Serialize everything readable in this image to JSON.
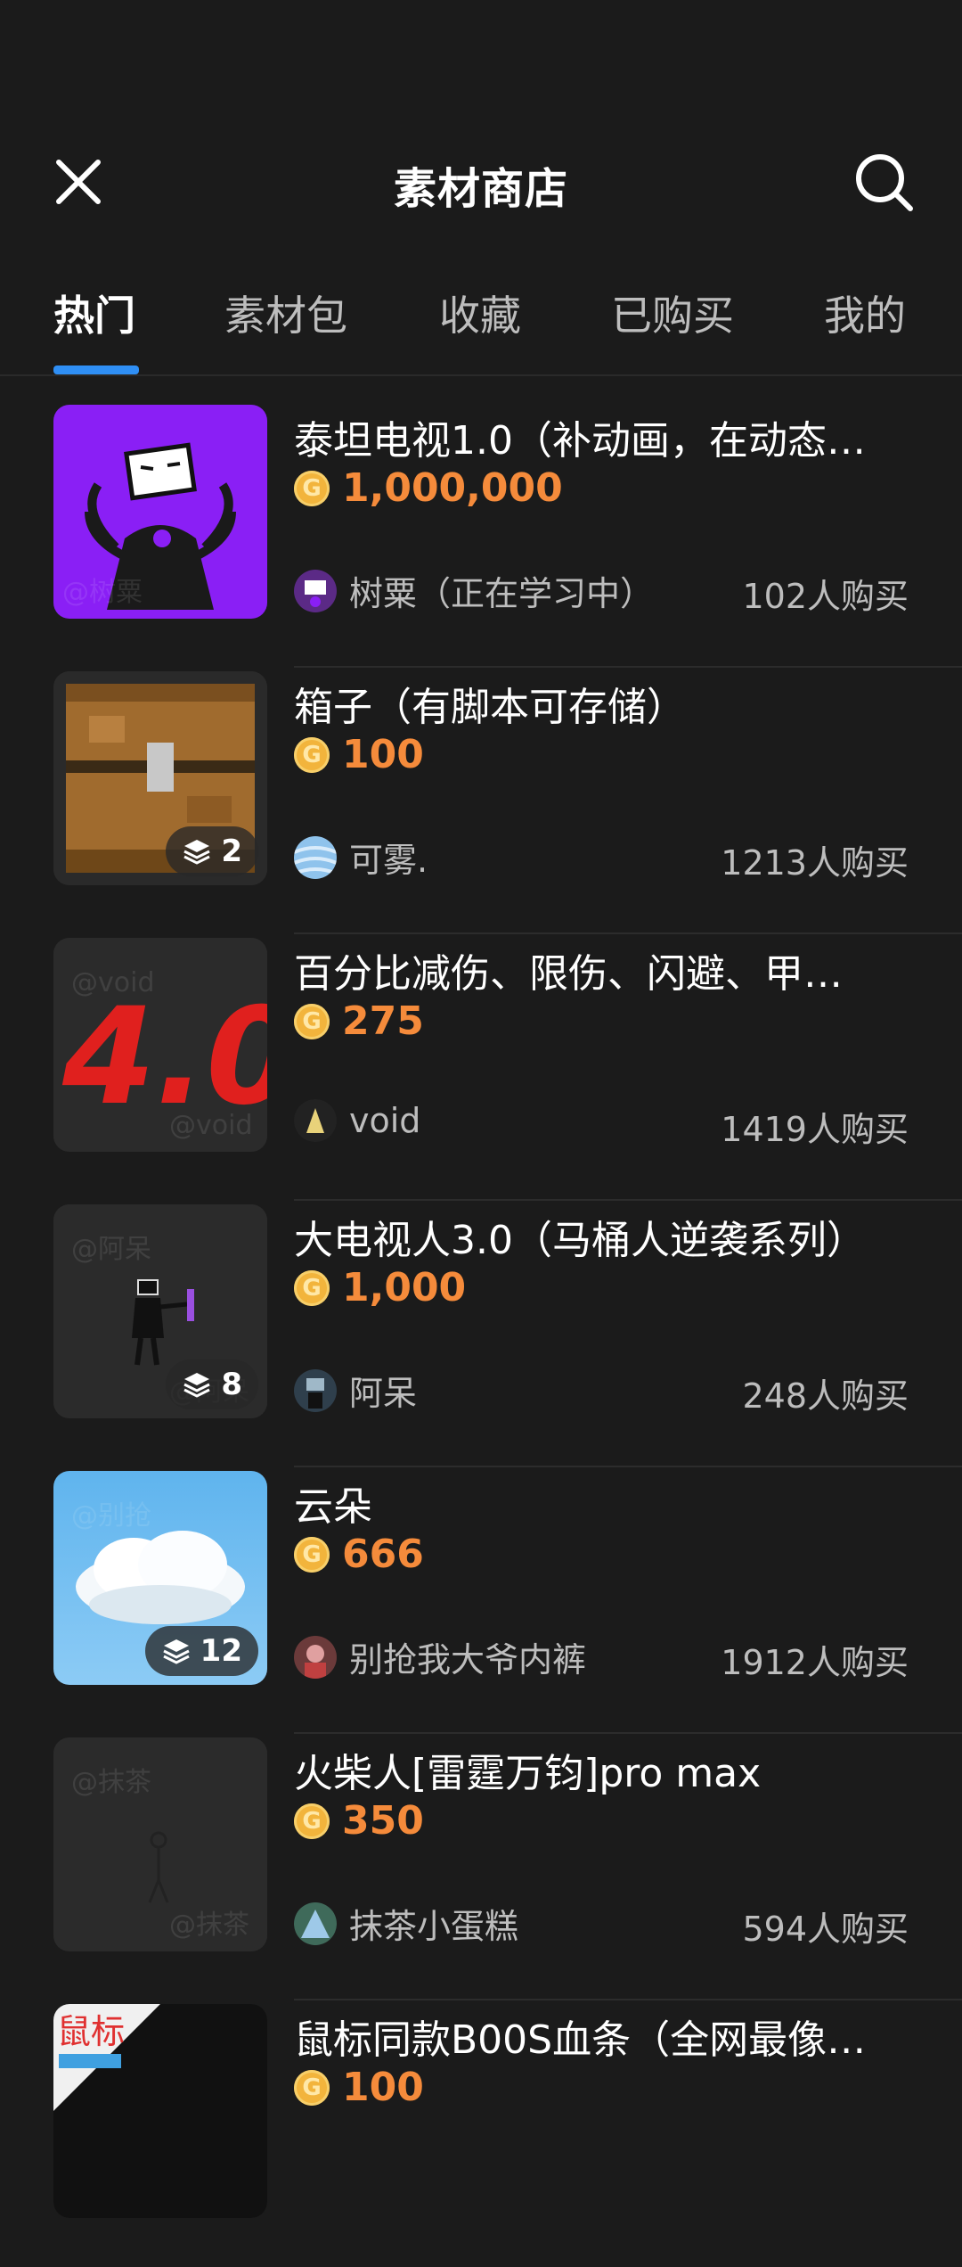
{
  "header": {
    "title": "素材商店"
  },
  "tabs": [
    {
      "label": "热门"
    },
    {
      "label": "素材包"
    },
    {
      "label": "收藏"
    },
    {
      "label": "已购买"
    },
    {
      "label": "我的"
    }
  ],
  "colors": {
    "background": "#1b1b1b",
    "accent_tab_indicator": "#2f8ff5",
    "price": "#f58b3b",
    "coin": "#f2b43c"
  },
  "items": [
    {
      "title": "泰坦电视1.0（补动画，在动态…",
      "price": "1,000,000",
      "author": "树粟（正在学习中）",
      "purchases": "102人购买"
    },
    {
      "title": "箱子（有脚本可存储）",
      "price": "100",
      "author": "可雾.",
      "purchases": "1213人购买",
      "layers": "2"
    },
    {
      "title": "百分比减伤、限伤、闪避、甲…",
      "price": "275",
      "author": "void",
      "purchases": "1419人购买"
    },
    {
      "title": "大电视人3.0（马桶人逆袭系列）",
      "price": "1,000",
      "author": "阿呆",
      "purchases": "248人购买",
      "layers": "8"
    },
    {
      "title": "云朵",
      "price": "666",
      "author": "别抢我大爷内裤",
      "purchases": "1912人购买",
      "layers": "12"
    },
    {
      "title": "火柴人[雷霆万钧]pro max",
      "price": "350",
      "author": "抹茶小蛋糕",
      "purchases": "594人购买"
    },
    {
      "title": "鼠标同款B00S血条（全网最像…",
      "price": "100",
      "author": "",
      "purchases": ""
    }
  ],
  "thumb_texts": {
    "item3": "4.0",
    "item7": "鼠标"
  }
}
